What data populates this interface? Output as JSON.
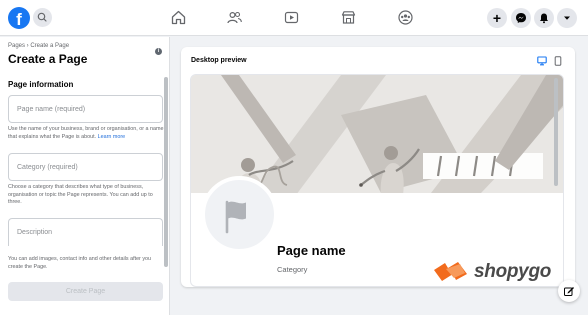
{
  "topbar": {
    "logo_letter": "f",
    "nav_icons": [
      "home-icon",
      "friends-icon",
      "watch-icon",
      "marketplace-icon",
      "groups-icon"
    ],
    "right_icons": [
      "plus-icon",
      "messenger-icon",
      "notifications-icon",
      "chevron-down-icon"
    ],
    "plus_label": "+"
  },
  "sidebar": {
    "breadcrumb": "Pages › Create a Page",
    "title": "Create a Page",
    "info_label": "i",
    "section_heading": "Page information",
    "page_name": {
      "placeholder": "Page name (required)",
      "help": "Use the name of your business, brand or organisation, or a name that explains what the Page is about.",
      "help_link": "Learn more"
    },
    "category": {
      "placeholder": "Category (required)",
      "help": "Choose a category that describes what type of business, organisation or topic the Page represents. You can add up to three."
    },
    "description": {
      "placeholder": "Description"
    },
    "footer_help": "You can add images, contact info and other details after you create the Page.",
    "create_button": "Create Page"
  },
  "preview": {
    "label": "Desktop preview",
    "page_name": "Page name",
    "category": "Category"
  },
  "watermark": {
    "text": "shopygo"
  },
  "colors": {
    "facebook_blue": "#1877f2",
    "link_blue": "#216fdb",
    "page_bg": "#f0f2f5",
    "watermark_orange": "#f26b1d"
  }
}
